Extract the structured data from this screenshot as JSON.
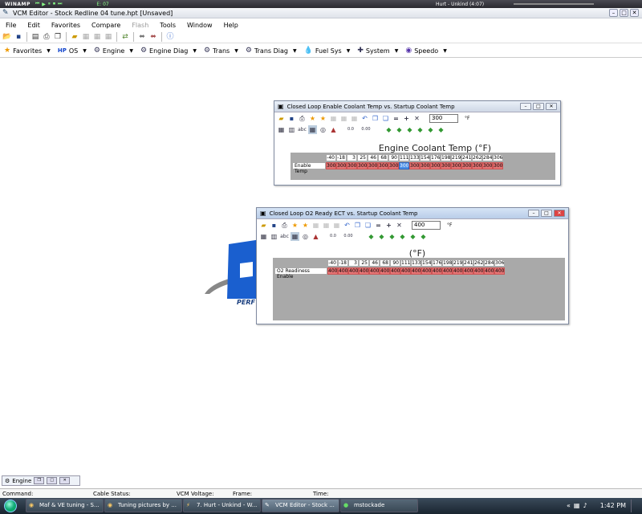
{
  "winamp": {
    "logo": "WINAMP",
    "counter": "E: 07",
    "song": "Hurt - Unkind (4:07)"
  },
  "window": {
    "title": "VCM Editor - Stock Redline 04 tune.hpt  [Unsaved]"
  },
  "menu": [
    "File",
    "Edit",
    "Favorites",
    "Compare",
    "Flash",
    "Tools",
    "Window",
    "Help"
  ],
  "toolbar2": [
    {
      "label": "Favorites",
      "icon": "star-icon"
    },
    {
      "label": "OS",
      "icon": "hp-icon",
      "prefix": "HP"
    },
    {
      "label": "Engine",
      "icon": "engine-icon"
    },
    {
      "label": "Engine Diag",
      "icon": "engine-diag-icon"
    },
    {
      "label": "Trans",
      "icon": "trans-icon"
    },
    {
      "label": "Trans Diag",
      "icon": "trans-diag-icon"
    },
    {
      "label": "Fuel Sys",
      "icon": "fuel-icon"
    },
    {
      "label": "System",
      "icon": "system-icon"
    },
    {
      "label": "Speedo",
      "icon": "speedo-icon"
    }
  ],
  "logo": {
    "text": "PERF"
  },
  "table1": {
    "title": "Closed Loop Enable Coolant Temp vs. Startup Coolant Temp",
    "value": "300",
    "unit": "°F",
    "grid_title": "Engine Coolant Temp (°F)",
    "row_label": "Enable Temp",
    "columns": [
      "-40",
      "-18",
      "3",
      "25",
      "46",
      "68",
      "90",
      "111",
      "133",
      "154",
      "176",
      "198",
      "219",
      "241",
      "262",
      "284",
      "306"
    ],
    "values": [
      "300",
      "300",
      "300",
      "300",
      "300",
      "300",
      "300",
      "300",
      "300",
      "300",
      "300",
      "300",
      "300",
      "300",
      "300",
      "300",
      "300"
    ],
    "selected_index": 7,
    "toolbar_labels": {
      "zero_a": "0.0",
      "zero_b": "0.00"
    }
  },
  "table2": {
    "title": "Closed Loop O2 Ready ECT vs. Startup Coolant Temp",
    "value": "400",
    "unit": "°F",
    "grid_title": "(°F)",
    "row_label": "O2 Readiness Enable",
    "columns": [
      "-40",
      "-18",
      "3",
      "25",
      "46",
      "68",
      "90",
      "111",
      "133",
      "154",
      "176",
      "198",
      "219",
      "241",
      "262",
      "284",
      "306"
    ],
    "values": [
      "400",
      "400",
      "400",
      "400",
      "400",
      "400",
      "400",
      "400",
      "400",
      "400",
      "400",
      "400",
      "400",
      "400",
      "400",
      "400",
      "400"
    ],
    "toolbar_labels": {
      "zero_a": "0.0",
      "zero_b": "0.00"
    }
  },
  "mdi_tab": {
    "label": "Engine"
  },
  "statusbar": {
    "command": "Command:",
    "cable": "Cable Status:",
    "vcm": "VCM Voltage:",
    "frame": "Frame:",
    "time": "Time:"
  },
  "taskbar": {
    "tasks": [
      "Maf & VE tuning - S...",
      "Tuning pictures by ...",
      "7. Hurt - Unkind - W...",
      "VCM Editor - Stock ...",
      "mstockade"
    ],
    "active_index": 3,
    "clock": "1:42 PM"
  }
}
